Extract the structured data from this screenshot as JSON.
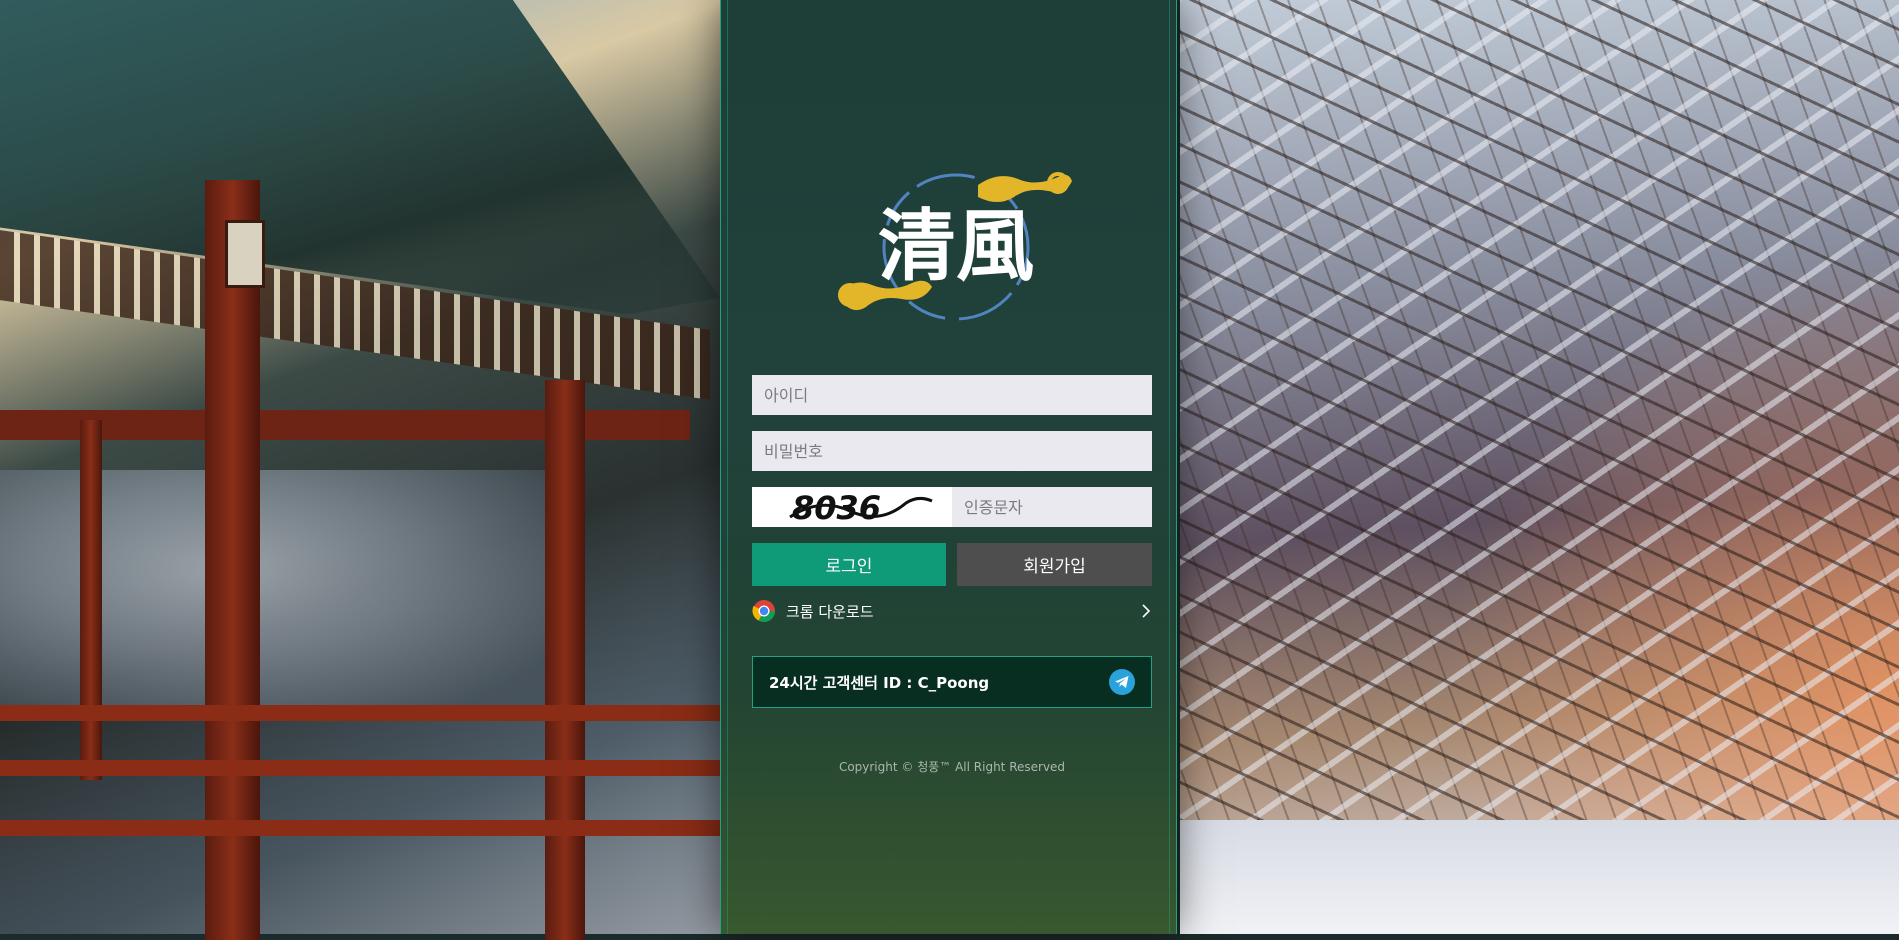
{
  "logo": {
    "text": "清風"
  },
  "login_form": {
    "id_placeholder": "아이디",
    "password_placeholder": "비밀번호",
    "captcha_code": "8036",
    "captcha_placeholder": "인증문자"
  },
  "buttons": {
    "login_label": "로그인",
    "join_label": "회원가입"
  },
  "chrome_download": {
    "label": "크롬 다운로드"
  },
  "support": {
    "label": "24시간 고객센터 ID : C_Poong"
  },
  "footer": {
    "copyright": "Copyright © 청풍™ All Right Reserved"
  },
  "colors": {
    "accent": "#0f9a78",
    "border": "#1fa384",
    "join_button": "#4e4e4e",
    "support_bg": "#082e22",
    "telegram": "#2aa3dc",
    "logo_gold": "#e3b62a"
  },
  "icons": {
    "chrome": "chrome-icon",
    "chevron": "chevron-right-icon",
    "telegram": "telegram-icon"
  }
}
